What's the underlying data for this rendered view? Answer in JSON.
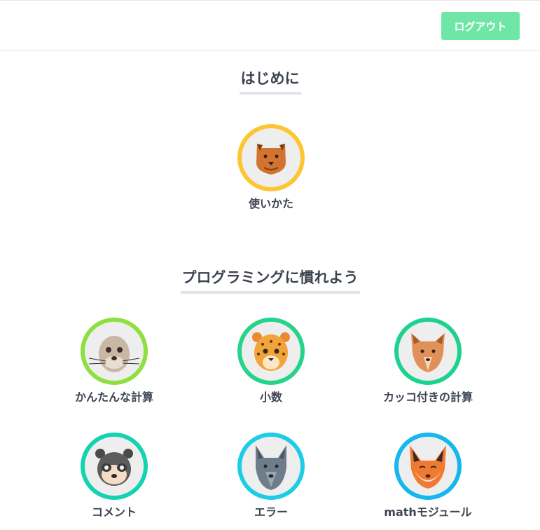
{
  "header": {
    "logout_label": "ログアウト",
    "logout_color": "#6ee7a6"
  },
  "sections": [
    {
      "title": "はじめに",
      "lessons": [
        {
          "label": "使いかた",
          "icon": "bear-icon",
          "ring_color": "#fdc530"
        }
      ]
    },
    {
      "title": "プログラミングに慣れよう",
      "lessons": [
        {
          "label": "かんたんな計算",
          "icon": "seal-icon",
          "ring_color": "#8ee040"
        },
        {
          "label": "小数",
          "icon": "leopard-icon",
          "ring_color": "#25d38a"
        },
        {
          "label": "カッコ付きの計算",
          "icon": "dog-icon",
          "ring_color": "#1bd38f"
        },
        {
          "label": "コメント",
          "icon": "raccoon-icon",
          "ring_color": "#14d3b0"
        },
        {
          "label": "エラー",
          "icon": "wolf-icon",
          "ring_color": "#1dcde8"
        },
        {
          "label": "mathモジュール",
          "icon": "fox-icon",
          "ring_color": "#15b7ef"
        }
      ]
    }
  ]
}
